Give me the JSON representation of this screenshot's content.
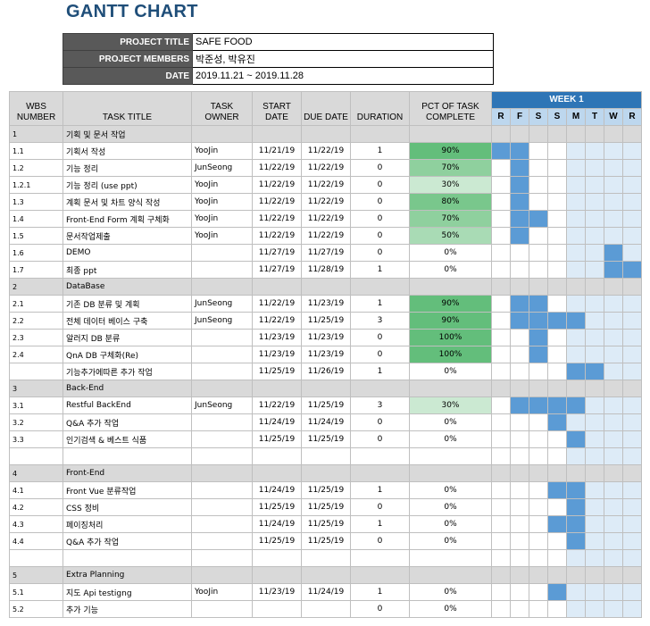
{
  "title": "GANTT CHART",
  "info": [
    {
      "label": "PROJECT TITLE",
      "value": "SAFE FOOD"
    },
    {
      "label": "PROJECT MEMBERS",
      "value": "박준성, 박유진"
    },
    {
      "label": "DATE",
      "value": "2019.11.21 ~ 2019.11.28"
    }
  ],
  "headers": {
    "wbs": "WBS\nNUMBER",
    "task": "TASK TITLE",
    "owner": "TASK\nOWNER",
    "start": "START\nDATE",
    "due": "DUE DATE",
    "duration": "DURATION",
    "pct": "PCT OF TASK\nCOMPLETE",
    "week": "WEEK 1",
    "days": [
      "R",
      "F",
      "S",
      "S",
      "M",
      "T",
      "W",
      "R"
    ]
  },
  "colors": {
    "bar": "#5b9bd5",
    "week_header": "#2e75b6",
    "title": "#1f4e79"
  },
  "rows": [
    {
      "type": "phase",
      "wbs": "1",
      "task": "기획 및 문서 작업"
    },
    {
      "wbs": "1.1",
      "task": "기획서 작성",
      "owner": "YooJin",
      "start": "11/21/19",
      "due": "11/22/19",
      "duration": "1",
      "pct": "90%",
      "pctv": 90,
      "bars": [
        0,
        1
      ]
    },
    {
      "wbs": "1.2",
      "task": "기능 정리",
      "owner": "JunSeong",
      "start": "11/22/19",
      "due": "11/22/19",
      "duration": "0",
      "pct": "70%",
      "pctv": 70,
      "bars": [
        1
      ]
    },
    {
      "wbs": "1.2.1",
      "task": "기능 정리 (use ppt)",
      "owner": "YooJin",
      "start": "11/22/19",
      "due": "11/22/19",
      "duration": "0",
      "pct": "30%",
      "pctv": 30,
      "bars": [
        1
      ]
    },
    {
      "wbs": "1.3",
      "task": "계획 문서 및 차트 양식 작성",
      "owner": "YooJin",
      "start": "11/22/19",
      "due": "11/22/19",
      "duration": "0",
      "pct": "80%",
      "pctv": 80,
      "bars": [
        1
      ]
    },
    {
      "wbs": "1.4",
      "task": "Front-End Form 계획 구체화",
      "owner": "YooJin",
      "start": "11/22/19",
      "due": "11/22/19",
      "duration": "0",
      "pct": "70%",
      "pctv": 70,
      "bars": [
        1,
        2
      ]
    },
    {
      "wbs": "1.5",
      "task": "문서작업제출",
      "owner": "YooJin",
      "start": "11/22/19",
      "due": "11/22/19",
      "duration": "0",
      "pct": "50%",
      "pctv": 50,
      "bars": [
        1
      ]
    },
    {
      "wbs": "1.6",
      "task": "DEMO",
      "owner": "",
      "start": "11/27/19",
      "due": "11/27/19",
      "duration": "0",
      "pct": "0%",
      "pctv": 0,
      "bars": [
        6
      ]
    },
    {
      "wbs": "1.7",
      "task": "최종 ppt",
      "owner": "",
      "start": "11/27/19",
      "due": "11/28/19",
      "duration": "1",
      "pct": "0%",
      "pctv": 0,
      "bars": [
        6,
        7
      ]
    },
    {
      "type": "phase",
      "wbs": "2",
      "task": "DataBase"
    },
    {
      "wbs": "2.1",
      "task": "기존 DB 분류 및 계획",
      "owner": "JunSeong",
      "start": "11/22/19",
      "due": "11/23/19",
      "duration": "1",
      "pct": "90%",
      "pctv": 90,
      "bars": [
        1,
        2
      ]
    },
    {
      "wbs": "2.2",
      "task": "전체 데이터 베이스 구축",
      "owner": "JunSeong",
      "start": "11/22/19",
      "due": "11/25/19",
      "duration": "3",
      "pct": "90%",
      "pctv": 90,
      "bars": [
        1,
        2,
        3,
        4
      ]
    },
    {
      "wbs": "2.3",
      "task": "알러지 DB 분류",
      "owner": "",
      "start": "11/23/19",
      "due": "11/23/19",
      "duration": "0",
      "pct": "100%",
      "pctv": 100,
      "bars": [
        2
      ]
    },
    {
      "wbs": "2.4",
      "task": "QnA DB 구체화(Re)",
      "owner": "",
      "start": "11/23/19",
      "due": "11/23/19",
      "duration": "0",
      "pct": "100%",
      "pctv": 100,
      "bars": [
        2
      ]
    },
    {
      "wbs": "",
      "task": "기능추가에따른 추가 작업",
      "owner": "",
      "start": "11/25/19",
      "due": "11/26/19",
      "duration": "1",
      "pct": "0%",
      "pctv": 0,
      "bars": [
        4,
        5
      ]
    },
    {
      "type": "phase",
      "wbs": "3",
      "task": "Back-End"
    },
    {
      "wbs": "3.1",
      "task": "Restful BackEnd",
      "owner": "JunSeong",
      "start": "11/22/19",
      "due": "11/25/19",
      "duration": "3",
      "pct": "30%",
      "pctv": 30,
      "bars": [
        1,
        2,
        3,
        4
      ]
    },
    {
      "wbs": "3.2",
      "task": "Q&A 추가 작업",
      "owner": "",
      "start": "11/24/19",
      "due": "11/24/19",
      "duration": "0",
      "pct": "0%",
      "pctv": 0,
      "bars": [
        3
      ]
    },
    {
      "wbs": "3.3",
      "task": "인기검색 & 베스트 식품",
      "owner": "",
      "start": "11/25/19",
      "due": "11/25/19",
      "duration": "0",
      "pct": "0%",
      "pctv": 0,
      "bars": [
        4
      ]
    },
    {
      "type": "blank"
    },
    {
      "type": "phase",
      "wbs": "4",
      "task": "Front-End"
    },
    {
      "wbs": "4.1",
      "task": "Front Vue 분류작업",
      "owner": "",
      "start": "11/24/19",
      "due": "11/25/19",
      "duration": "1",
      "pct": "0%",
      "pctv": 0,
      "bars": [
        3,
        4
      ]
    },
    {
      "wbs": "4.2",
      "task": "CSS 정비",
      "owner": "",
      "start": "11/25/19",
      "due": "11/25/19",
      "duration": "0",
      "pct": "0%",
      "pctv": 0,
      "bars": [
        4
      ]
    },
    {
      "wbs": "4.3",
      "task": "페이징처리",
      "owner": "",
      "start": "11/24/19",
      "due": "11/25/19",
      "duration": "1",
      "pct": "0%",
      "pctv": 0,
      "bars": [
        3,
        4
      ]
    },
    {
      "wbs": "4.4",
      "task": "Q&A 추가 작업",
      "owner": "",
      "start": "11/25/19",
      "due": "11/25/19",
      "duration": "0",
      "pct": "0%",
      "pctv": 0,
      "bars": [
        4
      ]
    },
    {
      "type": "blank"
    },
    {
      "type": "phase",
      "wbs": "5",
      "task": "Extra Planning"
    },
    {
      "wbs": "5.1",
      "task": "지도 Api testigng",
      "owner": "YooJin",
      "start": "11/23/19",
      "due": "11/24/19",
      "duration": "1",
      "pct": "0%",
      "pctv": 0,
      "bars": [
        3
      ]
    },
    {
      "wbs": "5.2",
      "task": "추가 기능",
      "owner": "",
      "start": "",
      "due": "",
      "duration": "0",
      "pct": "0%",
      "pctv": 0,
      "bars": []
    }
  ]
}
